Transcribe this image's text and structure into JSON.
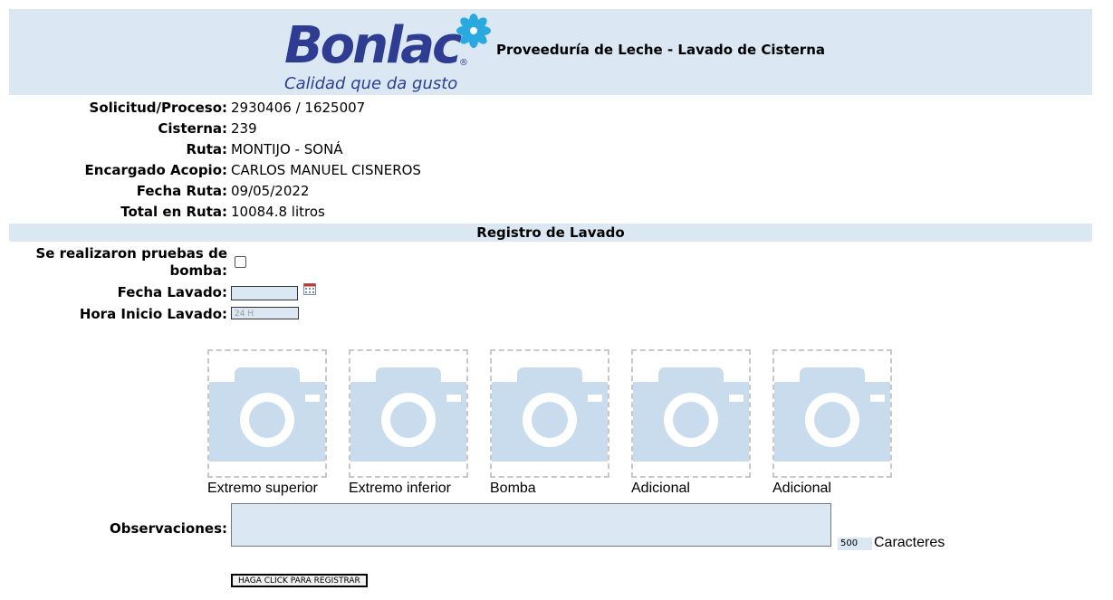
{
  "header": {
    "logo_text": "Bonlac",
    "logo_registered": "®",
    "logo_tagline": "Calidad que da gusto",
    "title": "Proveeduría de Leche - Lavado de Cisterna",
    "brand_color": "#2e3d91",
    "accent_color": "#29a9e0"
  },
  "info": [
    {
      "label": "Solicitud/Proceso:",
      "value": "2930406 / 1625007"
    },
    {
      "label": "Cisterna:",
      "value": "239"
    },
    {
      "label": "Ruta:",
      "value": "MONTIJO - SONÁ"
    },
    {
      "label": "Encargado Acopio:",
      "value": "CARLOS MANUEL CISNEROS"
    },
    {
      "label": "Fecha Ruta:",
      "value": "09/05/2022"
    },
    {
      "label": "Total en Ruta:",
      "value": "10084.8 litros"
    }
  ],
  "section_title": "Registro de Lavado",
  "form": {
    "pump_test_label": "Se realizaron pruebas de bomba:",
    "pump_test_checked": false,
    "wash_date_label": "Fecha Lavado:",
    "wash_date_value": "",
    "start_time_label": "Hora Inicio Lavado:",
    "start_time_placeholder": "24 H",
    "calendar_icon": "calendar-icon"
  },
  "photos": [
    {
      "caption": "Extremo superior",
      "icon": "camera-icon"
    },
    {
      "caption": "Extremo inferior",
      "icon": "camera-icon"
    },
    {
      "caption": "Bomba",
      "icon": "camera-icon"
    },
    {
      "caption": "Adicional",
      "icon": "camera-icon"
    },
    {
      "caption": "Adicional",
      "icon": "camera-icon"
    }
  ],
  "observations": {
    "label": "Observaciones:",
    "value": "",
    "remaining_chars": "500",
    "chars_label": "Caracteres"
  },
  "submit_label": "HAGA CLICK PARA REGISTRAR",
  "colors": {
    "panel_bg": "#dbe8f4",
    "camera_fill": "#c9dcee"
  }
}
